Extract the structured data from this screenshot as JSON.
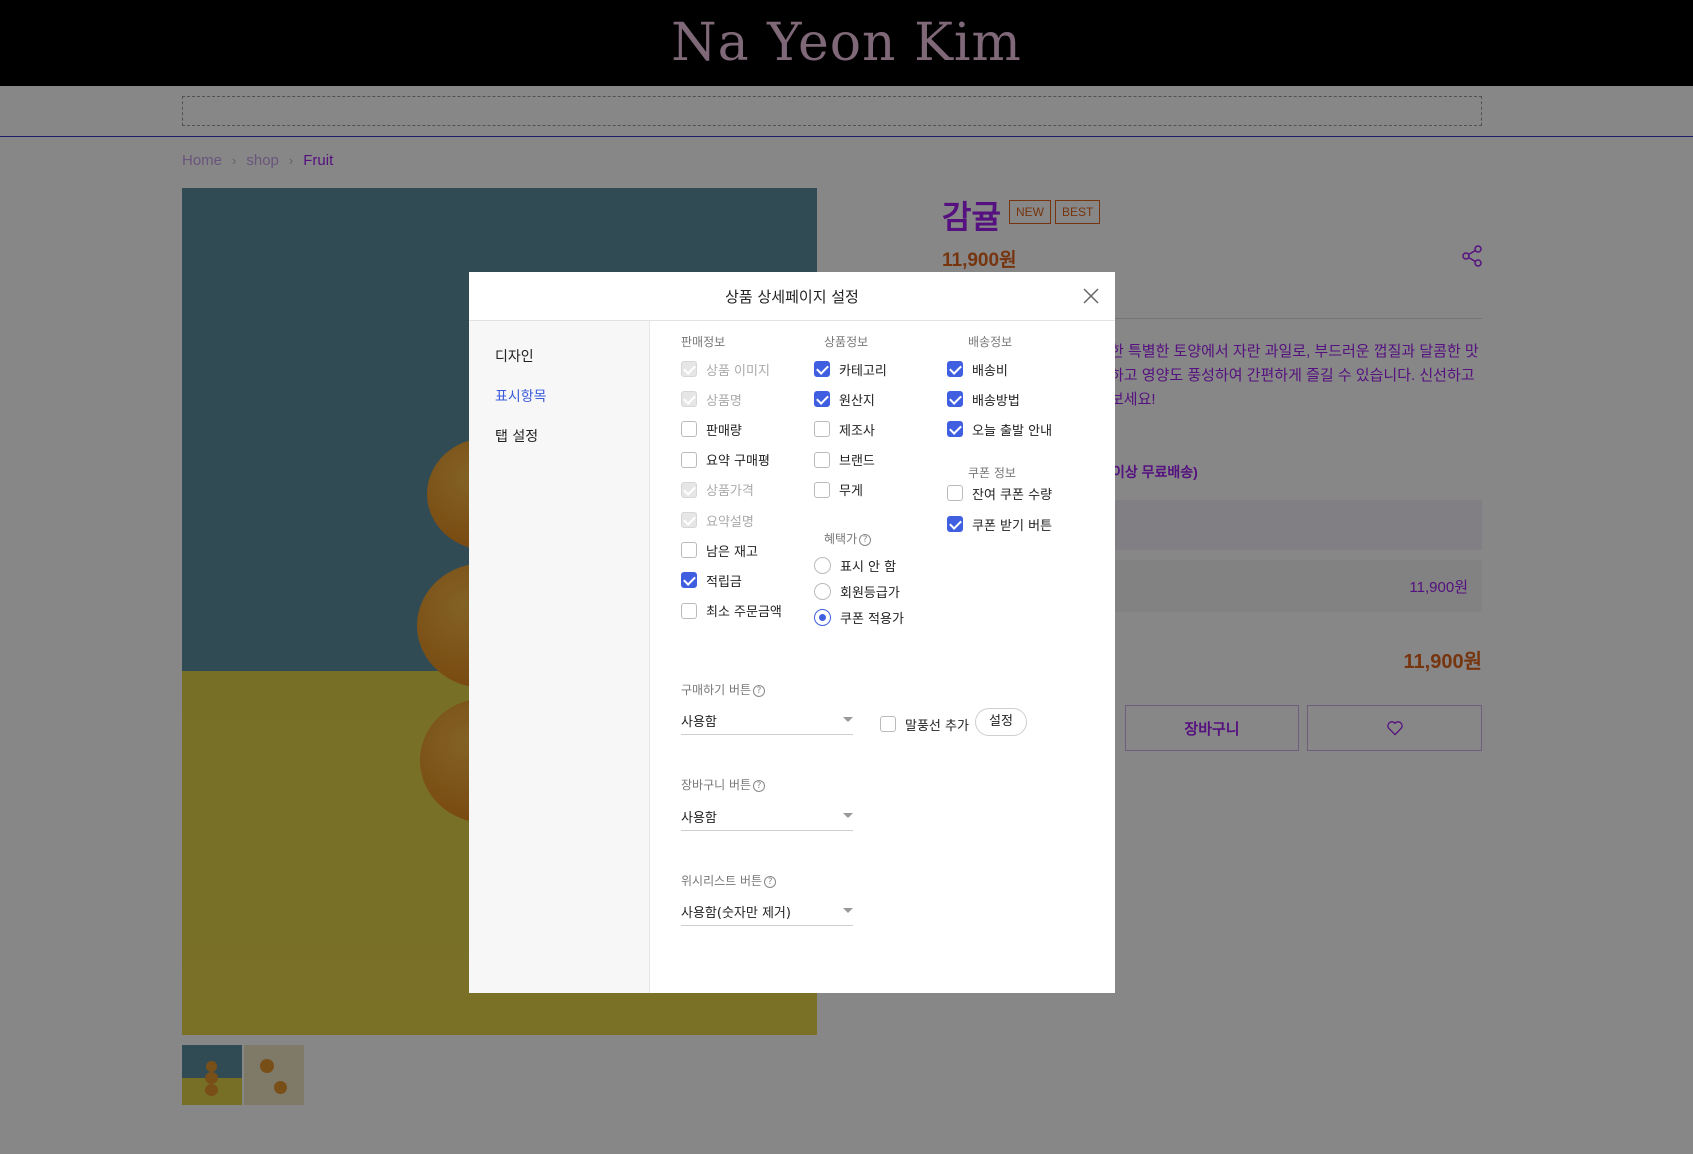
{
  "site": {
    "title": "Na Yeon Kim"
  },
  "breadcrumb": {
    "items": [
      "Home",
      "shop",
      "Fruit"
    ]
  },
  "product": {
    "name": "감귤",
    "badges": [
      "NEW",
      "BEST"
    ],
    "price": "11,900원",
    "description_visible": "한 특별한 토양에서 자란 과일로, 부드러운 껍질과 달콤한 맛하고 영양도 풍성하여 간편하게 즐길 수 있습니다. 신선하고보세요!",
    "shipping_fragment": "이상 무료배송)",
    "option_price": "11,900원",
    "total_price": "11,900원",
    "cart_label": "장바구니"
  },
  "modal": {
    "title": "상품 상세페이지 설정",
    "sidebar": {
      "items": [
        "디자인",
        "표시항목",
        "탭 설정"
      ],
      "active": "표시항목"
    },
    "sales_info": {
      "header": "판매정보",
      "items": [
        {
          "label": "상품 이미지",
          "checked": true,
          "disabled": true
        },
        {
          "label": "상품명",
          "checked": true,
          "disabled": true
        },
        {
          "label": "판매량",
          "checked": false,
          "disabled": false
        },
        {
          "label": "요약 구매평",
          "checked": false,
          "disabled": false
        },
        {
          "label": "상품가격",
          "checked": true,
          "disabled": true
        },
        {
          "label": "요약설명",
          "checked": true,
          "disabled": true
        },
        {
          "label": "남은 재고",
          "checked": false,
          "disabled": false
        },
        {
          "label": "적립금",
          "checked": true,
          "disabled": false
        },
        {
          "label": "최소 주문금액",
          "checked": false,
          "disabled": false
        }
      ]
    },
    "product_info": {
      "header": "상품정보",
      "items": [
        {
          "label": "카테고리",
          "checked": true
        },
        {
          "label": "원산지",
          "checked": true
        },
        {
          "label": "제조사",
          "checked": false
        },
        {
          "label": "브랜드",
          "checked": false
        },
        {
          "label": "무게",
          "checked": false
        }
      ]
    },
    "benefit_price": {
      "header": "혜택가",
      "options": [
        "표시 안 함",
        "회원등급가",
        "쿠폰 적용가"
      ],
      "selected": "쿠폰 적용가"
    },
    "shipping_info": {
      "header": "배송정보",
      "items": [
        {
          "label": "배송비",
          "checked": true
        },
        {
          "label": "배송방법",
          "checked": true
        },
        {
          "label": "오늘 출발 안내",
          "checked": true
        }
      ]
    },
    "coupon_info": {
      "header": "쿠폰 정보",
      "items": [
        {
          "label": "잔여 쿠폰 수량",
          "checked": false
        },
        {
          "label": "쿠폰 받기 버튼",
          "checked": true
        }
      ]
    },
    "buy_button": {
      "label": "구매하기 버튼",
      "value": "사용함",
      "bubble_label": "말풍선 추가",
      "bubble_checked": false,
      "settings_label": "설정"
    },
    "cart_button": {
      "label": "장바구니 버튼",
      "value": "사용함"
    },
    "wishlist_button": {
      "label": "위시리스트 버튼",
      "value": "사용함(숫자만 제거)"
    },
    "help_glyph": "?"
  },
  "colors": {
    "accent": "#3f5fe0",
    "brand": "#a020f0",
    "price": "#e0641e"
  }
}
